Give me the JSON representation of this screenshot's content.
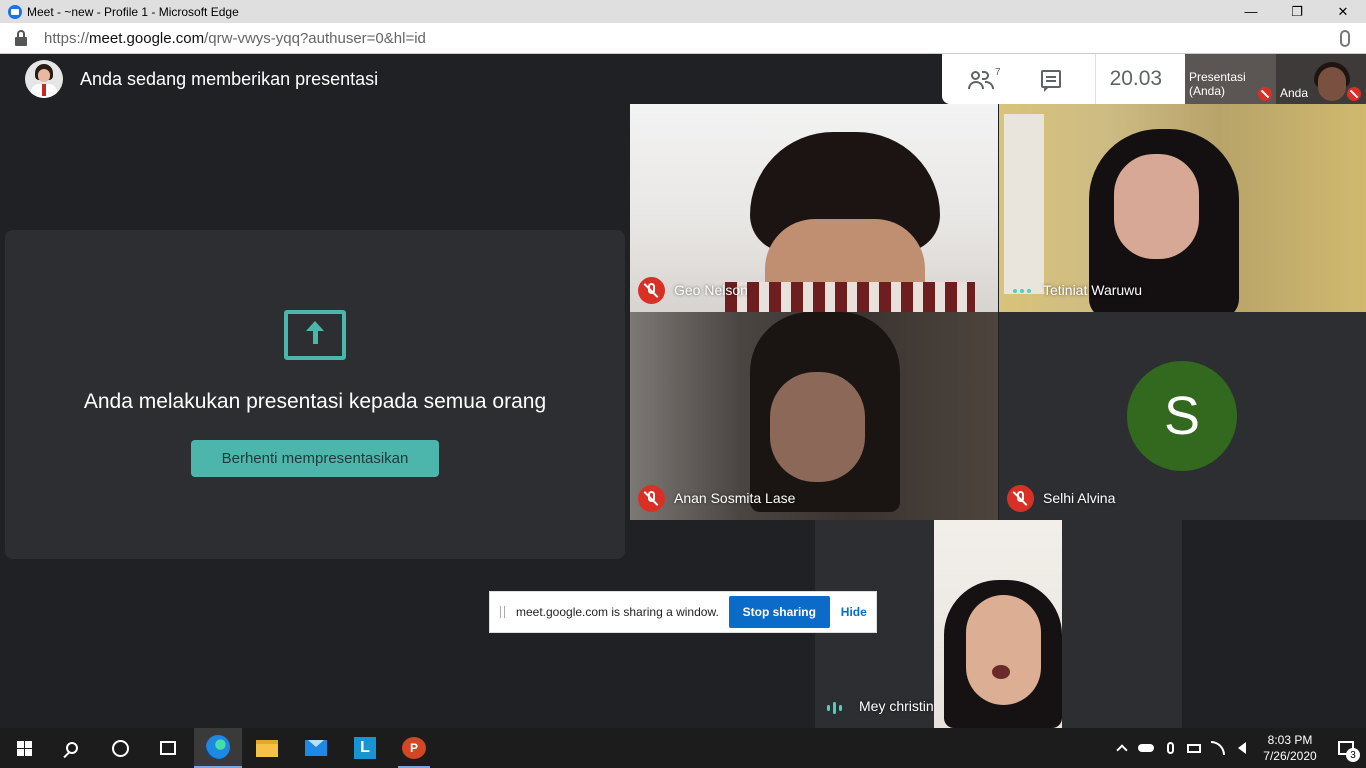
{
  "window": {
    "title": "Meet - ~new - Profile 1 - Microsoft Edge",
    "minimize": "—",
    "restore": "❐",
    "close": "✕"
  },
  "address_bar": {
    "url_prefix": "https://",
    "url_host": "meet.google.com",
    "url_path": "/qrw-vwys-yqq?authuser=0&hl=id"
  },
  "meet": {
    "presenting_title": "Anda sedang memberikan presentasi",
    "participant_count": "7",
    "time": "20.03",
    "mini_tiles": [
      {
        "label": "Presentasi (Anda)"
      },
      {
        "label": "Anda"
      }
    ],
    "present_panel": {
      "message": "Anda melakukan presentasi kepada semua orang",
      "stop_button": "Berhenti mempresentasikan"
    },
    "participants": [
      {
        "name": "Geo Nelson",
        "status": "muted"
      },
      {
        "name": "Tetiniat Waruwu",
        "status": "active"
      },
      {
        "name": "Anan Sosmita Lase",
        "status": "muted"
      },
      {
        "name": "Selhi Alvina",
        "status": "muted",
        "initial": "S",
        "avatar_color": "#33691e"
      },
      {
        "name": "Mey christin",
        "status": "speaking"
      }
    ],
    "accent_color": "#4db6ac"
  },
  "share_bar": {
    "message": "meet.google.com is sharing a window.",
    "stop_button": "Stop sharing",
    "hide_button": "Hide"
  },
  "taskbar": {
    "apps": [
      "start-icon",
      "search-icon",
      "cortana-icon",
      "task-view-icon",
      "edge-icon",
      "file-explorer-icon",
      "mail-icon",
      "l-app-icon",
      "powerpoint-icon"
    ],
    "l_app_letter": "L",
    "ppt_letter": "P",
    "time": "8:03 PM",
    "date": "7/26/2020",
    "notification_count": "3"
  }
}
